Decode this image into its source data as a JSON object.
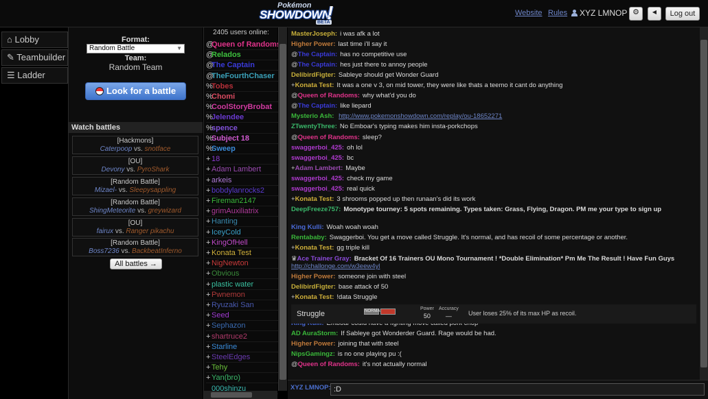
{
  "header": {
    "logo_top": "Pokémon",
    "logo_main": "SHOWDOWN",
    "logo_badge": "BETA",
    "logo_bang": "!",
    "website_link": "Website",
    "rules_link": "Rules",
    "username": "XYZ LMNOP",
    "logout_label": "Log out",
    "gear_icon": "⚙",
    "mute_icon": "◀"
  },
  "tabs": [
    {
      "icon": "home-icon",
      "label": "Lobby"
    },
    {
      "icon": "edit-icon",
      "label": "Teambuilder"
    },
    {
      "icon": "list-icon",
      "label": "Ladder"
    }
  ],
  "lobby": {
    "format_label": "Format:",
    "format_value": "Random Battle",
    "team_label": "Team:",
    "team_value": "Random Team",
    "look_button": "Look for a battle",
    "watch_header": "Watch battles",
    "all_battles": "All battles →",
    "battles": [
      {
        "format": "[Hackmons]",
        "p1": "Caterpoop",
        "p2": "snotface"
      },
      {
        "format": "[OU]",
        "p1": "Devony",
        "p2": "PyroShark"
      },
      {
        "format": "[Random Battle]",
        "p1": "Mizael-",
        "p2": "Sleepysappling"
      },
      {
        "format": "[Random Battle]",
        "p1": "ShingMeteorite",
        "p2": "greywizard"
      },
      {
        "format": "[OU]",
        "p1": "fairux",
        "p2": "Ranger pikachu"
      },
      {
        "format": "[Random Battle]",
        "p1": "Boss7236",
        "p2": "BackbeatInferno"
      }
    ],
    "vs_text": "vs."
  },
  "userlist": {
    "count_text": "2405 users online:",
    "users": [
      {
        "rank": "@",
        "name": "Queen of Randoms",
        "color": "#e0338a"
      },
      {
        "rank": "@",
        "name": "Relados",
        "color": "#3ec23e"
      },
      {
        "rank": "@",
        "name": "The Captain",
        "color": "#3a3ad8"
      },
      {
        "rank": "@",
        "name": "TheFourthChaser",
        "color": "#3aa0b8"
      },
      {
        "rank": "%",
        "name": "Tobes",
        "color": "#b8303a"
      },
      {
        "rank": "%",
        "name": "Chomi",
        "color": "#d84a60"
      },
      {
        "rank": "%",
        "name": "CoolStoryBrobat",
        "color": "#d03aa0"
      },
      {
        "rank": "%",
        "name": "Jelendee",
        "color": "#6a3ad0"
      },
      {
        "rank": "%",
        "name": "spence",
        "color": "#8050d8"
      },
      {
        "rank": "%",
        "name": "Subject 18",
        "color": "#d05ad0"
      },
      {
        "rank": "%",
        "name": "Sweep",
        "color": "#3a8ad8"
      },
      {
        "rank": "+",
        "name": "18",
        "color": "#8a3ad0"
      },
      {
        "rank": "+",
        "name": "Adam Lambert",
        "color": "#9a4ab0"
      },
      {
        "rank": "+",
        "name": "arkeis",
        "color": "#b07ad8"
      },
      {
        "rank": "+",
        "name": "bobdylanrocks2",
        "color": "#5a3ad0"
      },
      {
        "rank": "+",
        "name": "Fireman2147",
        "color": "#3ab83a"
      },
      {
        "rank": "+",
        "name": "grimAuxiliatrix",
        "color": "#b03a9a"
      },
      {
        "rank": "+",
        "name": "Hanting",
        "color": "#3a8ab0"
      },
      {
        "rank": "+",
        "name": "IceyCold",
        "color": "#3aa0c8"
      },
      {
        "rank": "+",
        "name": "KingOfHell",
        "color": "#c04ac8"
      },
      {
        "rank": "+",
        "name": "Konata Test",
        "color": "#d0b03a"
      },
      {
        "rank": "+",
        "name": "NigNewton",
        "color": "#c83a3a"
      },
      {
        "rank": "+",
        "name": "Obvious",
        "color": "#3a8a3a"
      },
      {
        "rank": "+",
        "name": "plastic water",
        "color": "#3ac0a0"
      },
      {
        "rank": "+",
        "name": "Pwnemon",
        "color": "#b03a3a"
      },
      {
        "rank": "+",
        "name": "Ryuzaki San",
        "color": "#4a5ab0"
      },
      {
        "rank": "+",
        "name": "Seed",
        "color": "#a03ad0"
      },
      {
        "rank": "+",
        "name": "Sephazon",
        "color": "#3a6ab0"
      },
      {
        "rank": "+",
        "name": "shartruce2",
        "color": "#b03a6a"
      },
      {
        "rank": "+",
        "name": "Starline",
        "color": "#3a8ad8"
      },
      {
        "rank": "+",
        "name": "SteelEdges",
        "color": "#6a3ab0"
      },
      {
        "rank": "+",
        "name": "Tehy",
        "color": "#6ac03a"
      },
      {
        "rank": "+",
        "name": "Yan(bro)",
        "color": "#3ab86a"
      },
      {
        "rank": "",
        "name": "000shinzu",
        "color": "#3ab8b0"
      }
    ]
  },
  "chat": {
    "messages": [
      {
        "rank": "",
        "name": "MasterJoseph:",
        "color": "#c8b03a",
        "text": "i was afk a lot"
      },
      {
        "rank": "",
        "name": "Higher Power:",
        "color": "#c07a3a",
        "text": "last time i'll say it"
      },
      {
        "rank": "@",
        "name": "The Captain:",
        "color": "#3a3ad8",
        "text": "has no competitive use"
      },
      {
        "rank": "@",
        "name": "The Captain:",
        "color": "#3a3ad8",
        "text": "hes just there to annoy people"
      },
      {
        "rank": "",
        "name": "DelibirdFigter:",
        "color": "#c8b03a",
        "text": "Sableye should get Wonder Guard"
      },
      {
        "rank": "+",
        "name": "Konata Test:",
        "color": "#d0b03a",
        "text": "It was a one v 3, on mid tower, they were like thats a teemo it cant do anything"
      },
      {
        "rank": "@",
        "name": "Queen of Randoms:",
        "color": "#e0338a",
        "text": "why what'd you do"
      },
      {
        "rank": "@",
        "name": "The Captain:",
        "color": "#3a3ad8",
        "text": "like liepard"
      },
      {
        "rank": "",
        "name": "Mysterio Ash:",
        "color": "#3ab83a",
        "text": "",
        "link": "http://www.pokemonshowdown.com/replay/ou-18652271"
      },
      {
        "rank": "",
        "name": "ZTwentyThree:",
        "color": "#3ab86a",
        "text": "No Emboar's typing makes him insta-porkchops"
      },
      {
        "rank": "@",
        "name": "Queen of Randoms:",
        "color": "#e0338a",
        "text": "sleep?"
      },
      {
        "rank": "",
        "name": "swaggerboi_425:",
        "color": "#b03ad0",
        "text": "oh lol"
      },
      {
        "rank": "",
        "name": "swaggerboi_425:",
        "color": "#b03ad0",
        "text": "bc"
      },
      {
        "rank": "+",
        "name": "Adam Lambert:",
        "color": "#9a4ab0",
        "text": "Maybe"
      },
      {
        "rank": "",
        "name": "swaggerboi_425:",
        "color": "#b03ad0",
        "text": "check my game"
      },
      {
        "rank": "",
        "name": "swaggerboi_425:",
        "color": "#b03ad0",
        "text": "real quick"
      },
      {
        "rank": "+",
        "name": "Konata Test:",
        "color": "#d0b03a",
        "text": "3 shrooms popped up then runaan's did its work"
      },
      {
        "rank": "",
        "name": "DeepFreeze757:",
        "color": "#3ab86a",
        "text": "Monotype tourney: 5 spots remaining. Types taken: Grass, Flying, Dragon. PM me your type to sign up",
        "bold": true
      },
      {
        "rank": "",
        "name": "King Kulli:",
        "color": "#4a6ad8",
        "text": "Woah woah woah"
      },
      {
        "rank": "",
        "name": "Rentababy:",
        "color": "#3ab83a",
        "text": "Swaggerboi. You get a move called Struggle. It's normal, and has recoil of some percentage or another."
      },
      {
        "rank": "+",
        "name": "Konata Test:",
        "color": "#d0b03a",
        "text": "gg triple kill"
      },
      {
        "rank": "♛",
        "name": "Ace Trainer Gray:",
        "color": "#8a4ad8",
        "text": "Bracket Of 16 Trainers OU Mono Tournament ! *Double Elimination* Pm Me The Result ! Have Fun Guys",
        "bold": true,
        "link": "http://challonge.com/w3eew4yl"
      },
      {
        "rank": "",
        "name": "Higher Power:",
        "color": "#c07a3a",
        "text": "someone join with steel"
      },
      {
        "rank": "",
        "name": "DelibirdFigter:",
        "color": "#c8b03a",
        "text": "base attack of 50"
      },
      {
        "rank": "+",
        "name": "Konata Test:",
        "color": "#d0b03a",
        "text": "!data Struggle"
      },
      {
        "rank": "",
        "name": "King Kulli:",
        "color": "#4a6ad8",
        "text": "Emboar could have a fighting move called pork chop"
      },
      {
        "rank": "",
        "name": "AD AuraStorm:",
        "color": "#3ab83a",
        "text": "If Sableye got Wonderder Guard. Rage would be had."
      },
      {
        "rank": "",
        "name": "Higher Power:",
        "color": "#c07a3a",
        "text": "joining that with steel"
      },
      {
        "rank": "",
        "name": "NipsGamingz:",
        "color": "#3ab83a",
        "text": "is no one playing pu :("
      },
      {
        "rank": "@",
        "name": "Queen of Randoms:",
        "color": "#e0338a",
        "text": "it's not actually normal"
      }
    ],
    "move": {
      "name": "Struggle",
      "type": "NORMAL",
      "power_label": "Power",
      "power": "50",
      "accuracy_label": "Accuracy",
      "accuracy": "—",
      "description": "User loses 25% of its max HP as recoil."
    },
    "self_name": "XYZ LMNOP:",
    "input_value": ":D"
  }
}
